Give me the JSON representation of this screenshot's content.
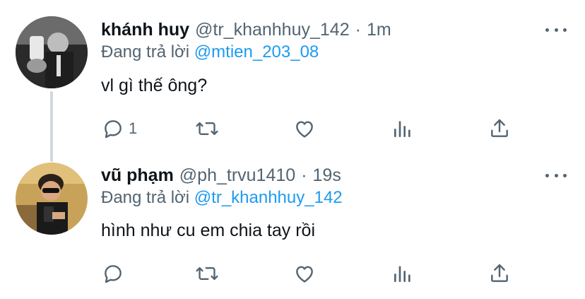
{
  "colors": {
    "link": "#1d9bf0",
    "secondary_text": "#536471",
    "primary_text": "#0f1419",
    "thread_line": "#cfd9de"
  },
  "tweets": [
    {
      "display_name": "khánh huy",
      "handle": "@tr_khanhhuy_142",
      "separator": "·",
      "time": "1m",
      "reply_prefix": "Đang trả lời",
      "reply_to": "@mtien_203_08",
      "text": "vl gì thế ông?",
      "reply_count": "1",
      "icons": [
        "reply-icon",
        "retweet-icon",
        "like-icon",
        "analytics-icon",
        "share-icon",
        "more-icon"
      ]
    },
    {
      "display_name": "vũ phạm",
      "handle": "@ph_trvu1410",
      "separator": "·",
      "time": "19s",
      "reply_prefix": "Đang trả lời",
      "reply_to": "@tr_khanhhuy_142",
      "text": "hình như cu em chia tay rồi",
      "reply_count": "",
      "icons": [
        "reply-icon",
        "retweet-icon",
        "like-icon",
        "analytics-icon",
        "share-icon",
        "more-icon"
      ]
    }
  ]
}
